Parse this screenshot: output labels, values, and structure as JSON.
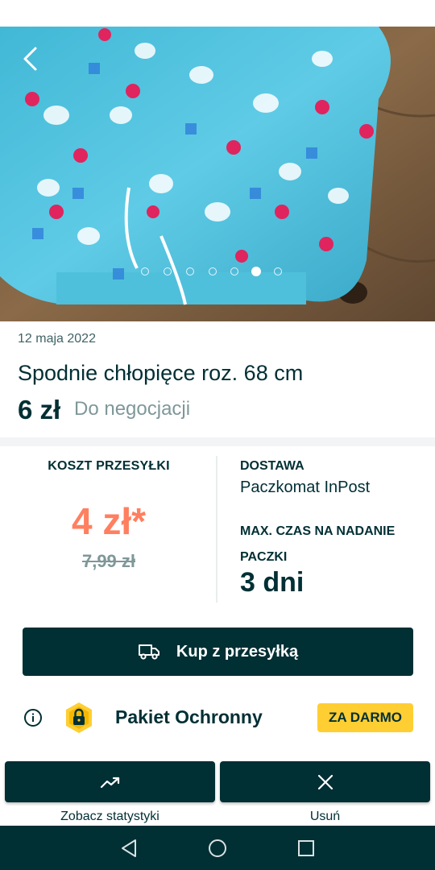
{
  "listing": {
    "date": "12 maja 2022",
    "title": "Spodnie chłopięce roz. 68 cm",
    "price": "6 zł",
    "negotiable": "Do negocjacji"
  },
  "gallery": {
    "image_count": 7,
    "active_index": 5
  },
  "shipping": {
    "cost_label": "KOSZT PRZESYŁKI",
    "cost_value": "4 zł*",
    "old_cost": "7,99 zł",
    "delivery_label": "DOSTAWA",
    "delivery_value": "Paczkomat InPost",
    "max_time_label": "MAX. CZAS NA NADANIE PACZKI",
    "max_time_value": "3 dni"
  },
  "buy_button": {
    "label": "Kup z przesyłką"
  },
  "protection": {
    "label": "Pakiet Ochronny",
    "badge": "ZA DARMO"
  },
  "actions": {
    "stats_label": "Zobacz statystyki",
    "delete_label": "Usuń"
  },
  "colors": {
    "primary": "#002f34",
    "accent_price": "#ff7f5f",
    "badge": "#ffce32",
    "muted": "#7f9799"
  },
  "icons": {
    "back": "chevron-left-icon",
    "truck": "truck-icon",
    "info": "info-icon",
    "lock": "lock-shield-icon",
    "stats": "trending-up-icon",
    "delete": "close-icon",
    "nav_back": "nav-back-icon",
    "nav_home": "nav-home-icon",
    "nav_recents": "nav-recents-icon"
  }
}
